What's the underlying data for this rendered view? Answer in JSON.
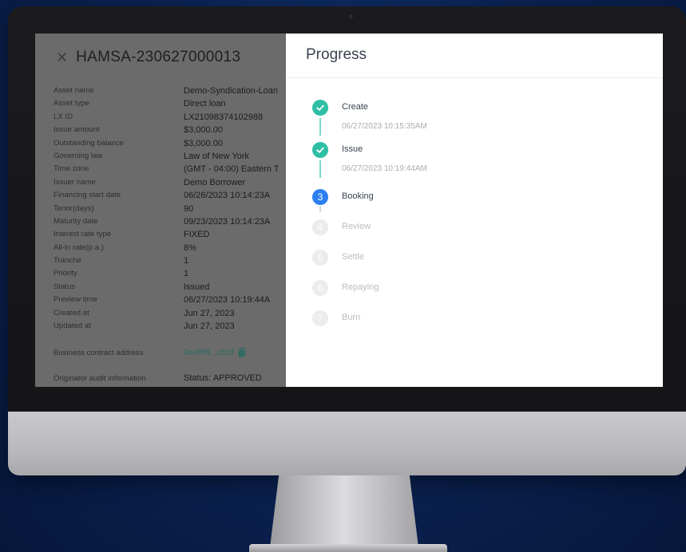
{
  "detail": {
    "title": "HAMSA-230627000013",
    "fields": [
      {
        "label": "Asset name",
        "value": "Demo-Syndication-Loan"
      },
      {
        "label": "Asset type",
        "value": "Direct loan"
      },
      {
        "label": "LX ID",
        "value": "LX21098374102988"
      },
      {
        "label": "Issue amount",
        "value": "$3,000.00"
      },
      {
        "label": "Outstanding balance",
        "value": "$3,000.00"
      },
      {
        "label": "Governing law",
        "value": "Law of New York"
      },
      {
        "label": "Time zone",
        "value": "(GMT - 04:00) Eastern T"
      },
      {
        "label": "Issuer name",
        "value": "Demo Borrower"
      },
      {
        "label": "Financing start date",
        "value": "06/26/2023 10:14:23A"
      },
      {
        "label": "Tenor(days)",
        "value": "90"
      },
      {
        "label": "Maturity date",
        "value": "09/23/2023 10:14:23A"
      },
      {
        "label": "Interest rate type",
        "value": "FIXED"
      },
      {
        "label": "All-in rate(p.a.)",
        "value": "8%"
      },
      {
        "label": "Tranche",
        "value": "1"
      },
      {
        "label": "Priority",
        "value": "1"
      },
      {
        "label": "Status",
        "value": "Issued"
      },
      {
        "label": "Preview time",
        "value": "06/27/2023 10:19:44A"
      },
      {
        "label": "Created at",
        "value": "Jun 27, 2023"
      },
      {
        "label": "Updated at",
        "value": "Jun 27, 2023"
      }
    ],
    "contract": {
      "label": "Business contract address",
      "value": "0x48f4...c0cf"
    },
    "audit": {
      "label": "Originator audit information",
      "value": "Status: APPROVED"
    }
  },
  "progress": {
    "title": "Progress",
    "steps": [
      {
        "number": "1",
        "label": "Create",
        "time": "06/27/2023 10:15:35AM",
        "state": "done"
      },
      {
        "number": "2",
        "label": "Issue",
        "time": "06/27/2023 10:19:44AM",
        "state": "done"
      },
      {
        "number": "3",
        "label": "Booking",
        "time": "",
        "state": "active"
      },
      {
        "number": "4",
        "label": "Review",
        "time": "",
        "state": "todo"
      },
      {
        "number": "5",
        "label": "Settle",
        "time": "",
        "state": "todo"
      },
      {
        "number": "6",
        "label": "Repaying",
        "time": "",
        "state": "todo"
      },
      {
        "number": "7",
        "label": "Burn",
        "time": "",
        "state": "todo"
      }
    ]
  },
  "icons": {
    "close": "close-icon",
    "check": "check-icon",
    "copy": "copy-icon"
  },
  "colors": {
    "done": "#2ebfa5",
    "active": "#2d7ff1",
    "todo": "#ececec"
  }
}
